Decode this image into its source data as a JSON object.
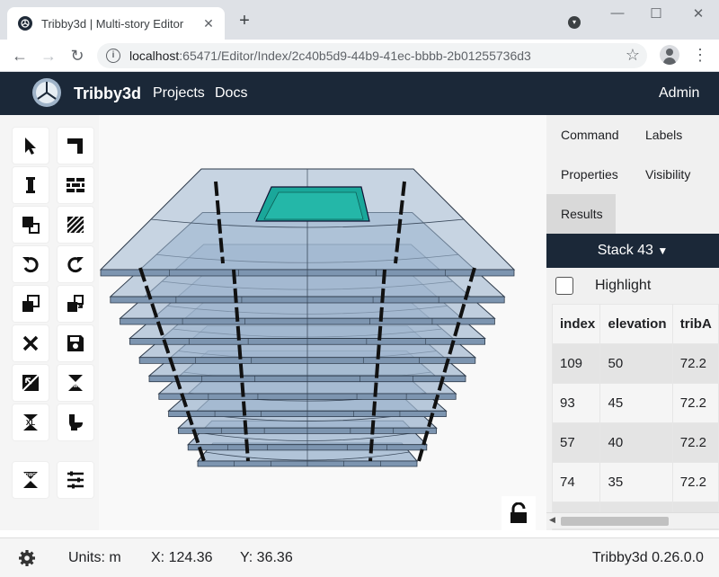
{
  "browser": {
    "tab_title": "Tribby3d | Multi-story Editor",
    "url_host": "localhost",
    "url_path": ":65471/Editor/Index/2c40b5d9-44b9-41ec-bbbb-2b01255736d3",
    "close_glyph": "✕",
    "new_tab_glyph": "+",
    "minimize_glyph": "—",
    "maximize_glyph": "☐",
    "window_close_glyph": "✕",
    "back_glyph": "←",
    "forward_glyph": "→",
    "reload_glyph": "↻",
    "star_glyph": "☆",
    "menu_glyph": "⋮",
    "info_glyph": "i"
  },
  "header": {
    "brand": "Tribby3d",
    "nav": [
      "Projects",
      "Docs"
    ],
    "user": "Admin",
    "bg_color": "#1b2838"
  },
  "tools": [
    {
      "icon": "pointer-icon"
    },
    {
      "icon": "corner-icon"
    },
    {
      "icon": "column-icon"
    },
    {
      "icon": "wall-icon"
    },
    {
      "icon": "slab-icon"
    },
    {
      "icon": "hatch-icon"
    },
    {
      "icon": "undo-icon"
    },
    {
      "icon": "redo-icon"
    },
    {
      "icon": "copy-icon"
    },
    {
      "icon": "paste-icon"
    },
    {
      "icon": "delete-icon"
    },
    {
      "icon": "save-icon"
    },
    {
      "icon": "import-icon"
    },
    {
      "icon": "export-dwg-icon"
    },
    {
      "icon": "export-xl-icon"
    },
    {
      "icon": "toilet-icon"
    },
    {
      "icon": "import-dwg-icon"
    },
    {
      "icon": "settings-sliders-icon"
    }
  ],
  "panel": {
    "tabs": [
      "Command",
      "Labels",
      "Properties",
      "Visibility",
      "Results"
    ],
    "active_tab": "Results",
    "stack_label": "Stack 43",
    "highlight_label": "Highlight",
    "table": {
      "columns": [
        "index",
        "elevation",
        "tribA"
      ],
      "rows": [
        [
          "109",
          "50",
          "72.2"
        ],
        [
          "93",
          "45",
          "72.2"
        ],
        [
          "57",
          "40",
          "72.2"
        ],
        [
          "74",
          "35",
          "72.2"
        ],
        [
          "",
          "",
          ""
        ]
      ]
    }
  },
  "status": {
    "units": "Units: m",
    "x": "X: 124.36",
    "y": "Y: 36.36",
    "version": "Tribby3d 0.26.0.0"
  },
  "model": {
    "floors": 11,
    "accent_color": "#1aa79a",
    "slab_color": "#9fb6cf"
  }
}
